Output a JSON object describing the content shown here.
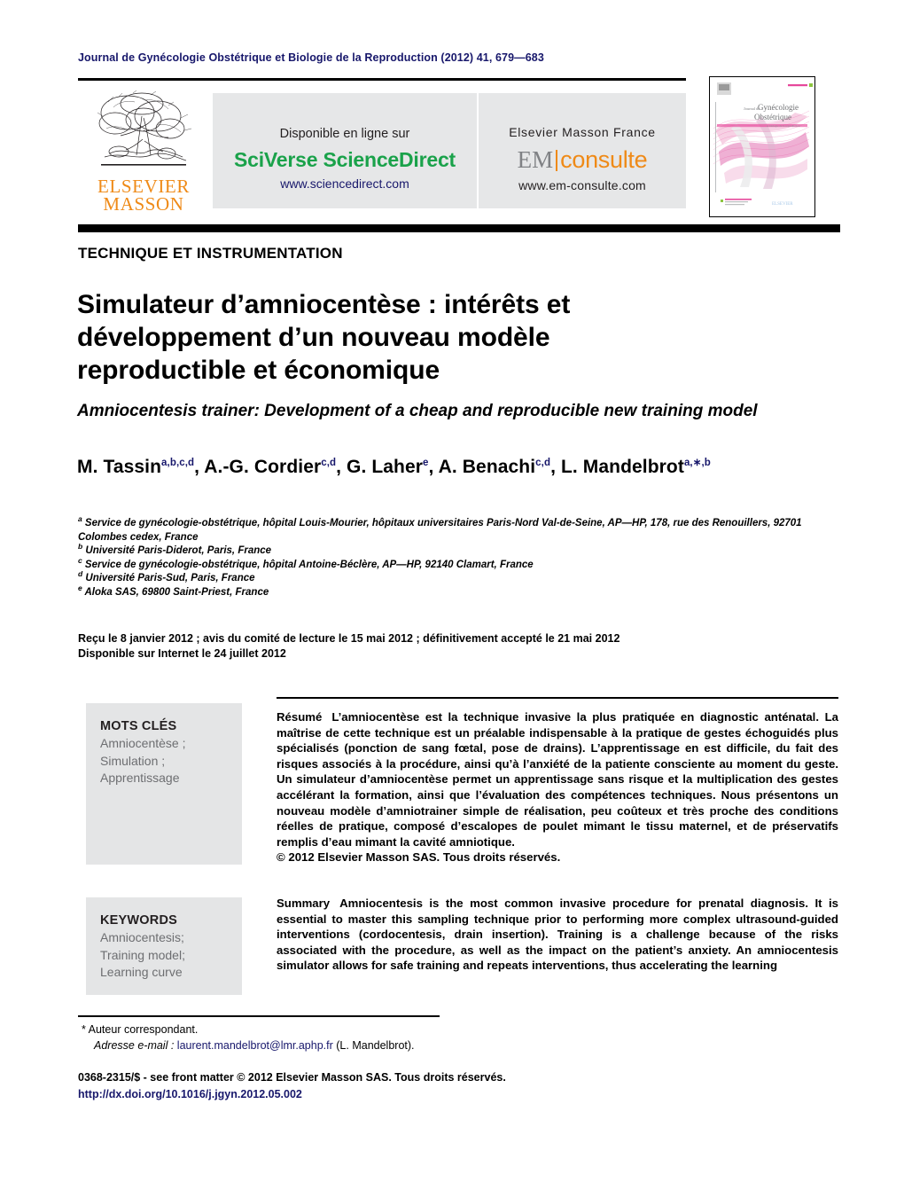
{
  "header": {
    "running_head": "Journal de Gynécologie Obstétrique et Biologie de la Reproduction (2012) 41, 679—683"
  },
  "banner": {
    "publisher_logo_line1": "ELSEVIER",
    "publisher_logo_line2": "MASSON",
    "sciencedirect": {
      "available_label": "Disponible en ligne sur",
      "brand": "SciVerse ScienceDirect",
      "url": "www.sciencedirect.com"
    },
    "emconsulte": {
      "publisher": "Elsevier Masson France",
      "brand_left": "EM",
      "brand_right": "consulte",
      "url": "www.em-consulte.com"
    },
    "cover": {
      "line1": "Journal de",
      "line2": "Gynécologie",
      "line3": "Obstétrique",
      "line4": "et Biologie de la Reproduction"
    }
  },
  "article": {
    "section_kicker": "TECHNIQUE ET INSTRUMENTATION",
    "title_fr": "Simulateur d’amniocentèse : intérêts et développement d’un nouveau modèle reproductible et économique",
    "title_en": "Amniocentesis trainer: Development of a cheap and reproducible new training model",
    "authors": [
      {
        "name": "M. Tassin",
        "marks": "a,b,c,d",
        "sep": ", "
      },
      {
        "name": "A.-G. Cordier",
        "marks": "c,d",
        "sep": ", "
      },
      {
        "name": "G. Laher",
        "marks": "e",
        "sep": ", "
      },
      {
        "name": "A. Benachi",
        "marks": "c,d",
        "sep": ", "
      },
      {
        "name": "L. Mandelbrot",
        "marks": "a,∗,b",
        "sep": ""
      }
    ],
    "affiliations": [
      {
        "mark": "a",
        "text": "Service de gynécologie-obstétrique, hôpital Louis-Mourier, hôpitaux universitaires Paris-Nord Val-de-Seine, AP—HP, 178, rue des Renouillers, 92701 Colombes cedex, France"
      },
      {
        "mark": "b",
        "text": "Université Paris-Diderot, Paris, France"
      },
      {
        "mark": "c",
        "text": "Service de gynécologie-obstétrique, hôpital Antoine-Béclère, AP—HP, 92140 Clamart, France"
      },
      {
        "mark": "d",
        "text": "Université Paris-Sud, Paris, France"
      },
      {
        "mark": "e",
        "text": "Aloka SAS, 69800 Saint-Priest, France"
      }
    ],
    "dates_line1": "Reçu le 8 janvier 2012 ; avis du comité de lecture le 15 mai 2012 ; définitivement accepté le 21 mai 2012",
    "dates_line2": "Disponible sur Internet le 24 juillet 2012"
  },
  "keywords_fr": {
    "heading": "MOTS CLÉS",
    "terms": "Amniocentèse ;\nSimulation ;\nApprentissage"
  },
  "keywords_en": {
    "heading": "KEYWORDS",
    "terms": "Amniocentesis;\nTraining model;\nLearning curve"
  },
  "abstract_fr": {
    "lead": "Résumé",
    "body": "L’amniocentèse est la technique invasive la plus pratiquée en diagnostic anténatal. La maîtrise de cette technique est un préalable indispensable à la pratique de gestes échoguidés plus spécialisés (ponction de sang fœtal, pose de drains). L’apprentissage en est difficile, du fait des risques associés à la procédure, ainsi qu’à l’anxiété de la patiente consciente au moment du geste. Un simulateur d’amniocentèse permet un apprentissage sans risque et la multiplication des gestes accélérant la formation, ainsi que l’évaluation des compétences techniques. Nous présentons un nouveau modèle d’amniotrainer simple de réalisation, peu coûteux et très proche des conditions réelles de pratique, composé d’escalopes de poulet mimant le tissu maternel, et de préservatifs remplis d’eau mimant la cavité amniotique.",
    "copyright": "© 2012 Elsevier Masson SAS. Tous droits réservés."
  },
  "abstract_en": {
    "lead": "Summary",
    "body": "Amniocentesis is the most common invasive procedure for prenatal diagnosis. It is essential to master this sampling technique prior to performing more complex ultrasound-guided interventions (cordocentesis, drain insertion). Training is a challenge because of the risks associated with the procedure, as well as the impact on the patient’s anxiety. An amniocentesis simulator allows for safe training and repeats interventions, thus accelerating the learning"
  },
  "footnote": {
    "corresponding": "* Auteur correspondant.",
    "email_label": "Adresse e-mail :",
    "email": "laurent.mandelbrot@lmr.aphp.fr",
    "email_owner": "(L. Mandelbrot)."
  },
  "colophon": {
    "front_matter": "0368-2315/$ - see front matter © 2012 Elsevier Masson SAS. Tous droits réservés.",
    "doi": "http://dx.doi.org/10.1016/j.jgyn.2012.05.002"
  },
  "colors": {
    "navy": "#17176b",
    "elsevier_orange": "#ef8a17",
    "sciencedirect_green": "#1aa24a",
    "grey_panel": "#e6e7e8",
    "keyword_panel": "#e4e5e6"
  }
}
